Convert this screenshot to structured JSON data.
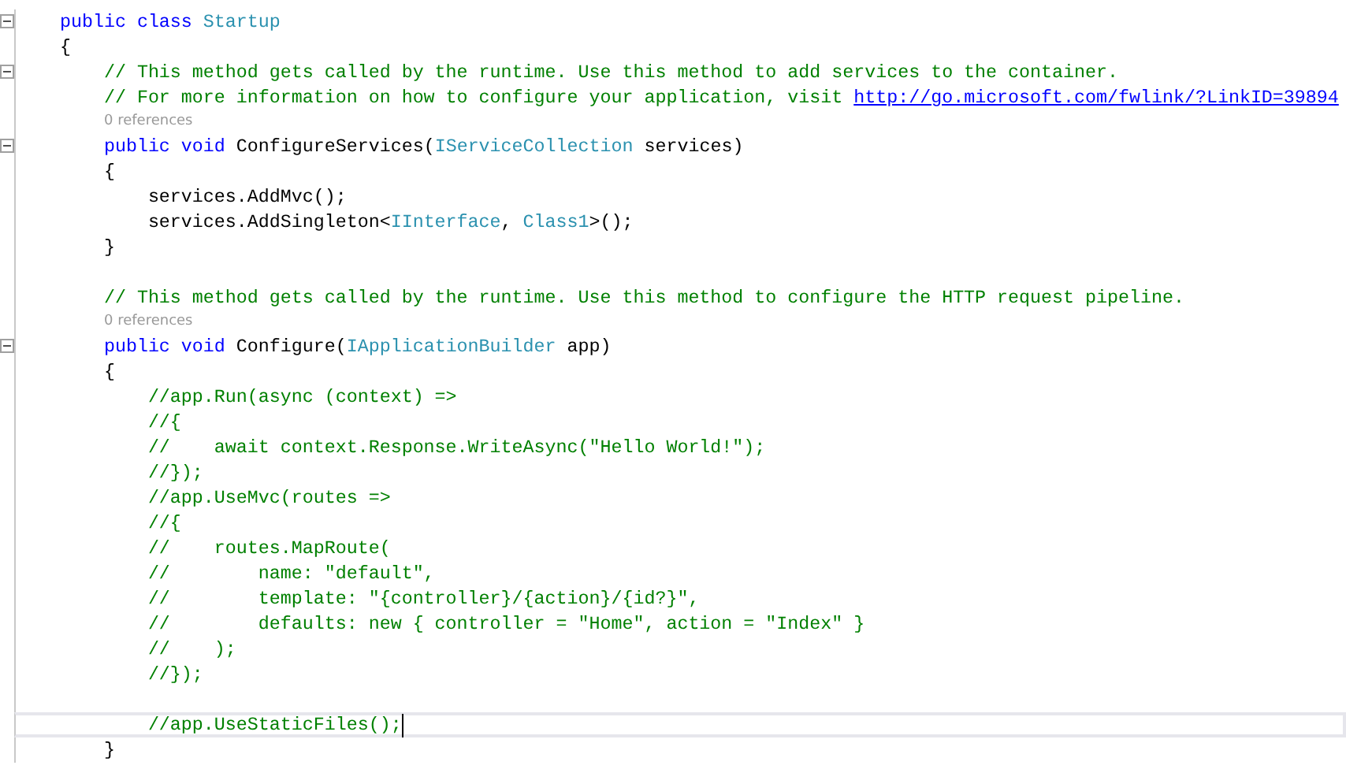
{
  "editor": {
    "lines": [
      {
        "kind": "code",
        "foldable": true,
        "current": false,
        "segments": [
          {
            "kind": "keyword",
            "text": "    public class "
          },
          {
            "kind": "type",
            "text": "Startup"
          }
        ]
      },
      {
        "kind": "code",
        "foldable": false,
        "current": false,
        "segments": [
          {
            "kind": "plain",
            "text": "    {"
          }
        ]
      },
      {
        "kind": "code",
        "foldable": true,
        "current": false,
        "segments": [
          {
            "kind": "comment",
            "text": "        // This method gets called by the runtime. Use this method to add services to the container."
          }
        ]
      },
      {
        "kind": "code",
        "foldable": false,
        "current": false,
        "segments": [
          {
            "kind": "comment",
            "text": "        // For more information on how to configure your application, visit "
          },
          {
            "kind": "link",
            "text": "http://go.microsoft.com/fwlink/?LinkID=39894"
          }
        ]
      },
      {
        "kind": "lens",
        "text": "0 references"
      },
      {
        "kind": "code",
        "foldable": true,
        "current": false,
        "segments": [
          {
            "kind": "keyword",
            "text": "        public void "
          },
          {
            "kind": "plain",
            "text": "ConfigureServices("
          },
          {
            "kind": "type",
            "text": "IServiceCollection"
          },
          {
            "kind": "plain",
            "text": " services)"
          }
        ]
      },
      {
        "kind": "code",
        "foldable": false,
        "current": false,
        "segments": [
          {
            "kind": "plain",
            "text": "        {"
          }
        ]
      },
      {
        "kind": "code",
        "foldable": false,
        "current": false,
        "segments": [
          {
            "kind": "plain",
            "text": "            services.AddMvc();"
          }
        ]
      },
      {
        "kind": "code",
        "foldable": false,
        "current": false,
        "segments": [
          {
            "kind": "plain",
            "text": "            services.AddSingleton<"
          },
          {
            "kind": "type",
            "text": "IInterface"
          },
          {
            "kind": "plain",
            "text": ", "
          },
          {
            "kind": "type",
            "text": "Class1"
          },
          {
            "kind": "plain",
            "text": ">();"
          }
        ]
      },
      {
        "kind": "code",
        "foldable": false,
        "current": false,
        "segments": [
          {
            "kind": "plain",
            "text": "        }"
          }
        ]
      },
      {
        "kind": "blank"
      },
      {
        "kind": "code",
        "foldable": false,
        "current": false,
        "segments": [
          {
            "kind": "comment",
            "text": "        // This method gets called by the runtime. Use this method to configure the HTTP request pipeline."
          }
        ]
      },
      {
        "kind": "lens",
        "text": "0 references"
      },
      {
        "kind": "code",
        "foldable": true,
        "current": false,
        "segments": [
          {
            "kind": "keyword",
            "text": "        public void "
          },
          {
            "kind": "plain",
            "text": "Configure("
          },
          {
            "kind": "type",
            "text": "IApplicationBuilder"
          },
          {
            "kind": "plain",
            "text": " app)"
          }
        ]
      },
      {
        "kind": "code",
        "foldable": false,
        "current": false,
        "segments": [
          {
            "kind": "plain",
            "text": "        {"
          }
        ]
      },
      {
        "kind": "code",
        "foldable": false,
        "current": false,
        "segments": [
          {
            "kind": "comment",
            "text": "            //app.Run(async (context) =>"
          }
        ]
      },
      {
        "kind": "code",
        "foldable": false,
        "current": false,
        "segments": [
          {
            "kind": "comment",
            "text": "            //{"
          }
        ]
      },
      {
        "kind": "code",
        "foldable": false,
        "current": false,
        "segments": [
          {
            "kind": "comment",
            "text": "            //    await context.Response.WriteAsync(\"Hello World!\");"
          }
        ]
      },
      {
        "kind": "code",
        "foldable": false,
        "current": false,
        "segments": [
          {
            "kind": "comment",
            "text": "            //});"
          }
        ]
      },
      {
        "kind": "code",
        "foldable": false,
        "current": false,
        "segments": [
          {
            "kind": "comment",
            "text": "            //app.UseMvc(routes =>"
          }
        ]
      },
      {
        "kind": "code",
        "foldable": false,
        "current": false,
        "segments": [
          {
            "kind": "comment",
            "text": "            //{"
          }
        ]
      },
      {
        "kind": "code",
        "foldable": false,
        "current": false,
        "segments": [
          {
            "kind": "comment",
            "text": "            //    routes.MapRoute("
          }
        ]
      },
      {
        "kind": "code",
        "foldable": false,
        "current": false,
        "segments": [
          {
            "kind": "comment",
            "text": "            //        name: \"default\","
          }
        ]
      },
      {
        "kind": "code",
        "foldable": false,
        "current": false,
        "segments": [
          {
            "kind": "comment",
            "text": "            //        template: \"{controller}/{action}/{id?}\","
          }
        ]
      },
      {
        "kind": "code",
        "foldable": false,
        "current": false,
        "segments": [
          {
            "kind": "comment",
            "text": "            //        defaults: new { controller = \"Home\", action = \"Index\" }"
          }
        ]
      },
      {
        "kind": "code",
        "foldable": false,
        "current": false,
        "segments": [
          {
            "kind": "comment",
            "text": "            //    );"
          }
        ]
      },
      {
        "kind": "code",
        "foldable": false,
        "current": false,
        "segments": [
          {
            "kind": "comment",
            "text": "            //});"
          }
        ]
      },
      {
        "kind": "blank"
      },
      {
        "kind": "code",
        "foldable": false,
        "current": true,
        "segments": [
          {
            "kind": "comment",
            "text": "            //app.UseStaticFiles();"
          }
        ]
      },
      {
        "kind": "code",
        "foldable": false,
        "current": false,
        "segments": [
          {
            "kind": "plain",
            "text": "        }"
          }
        ]
      }
    ]
  }
}
